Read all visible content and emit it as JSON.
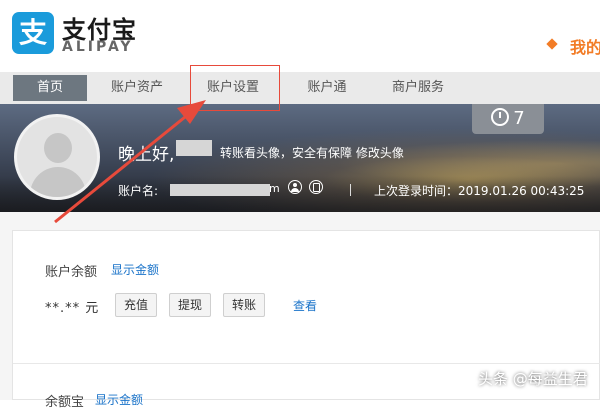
{
  "header": {
    "logo_glyph": "支",
    "logo_cn": "支付宝",
    "logo_en": "ALIPAY",
    "my_text": "我的",
    "accent_color": "#f27c26",
    "brand_color": "#1a9bdb"
  },
  "nav": {
    "items": [
      {
        "label": "首页",
        "active": true
      },
      {
        "label": "账户资产",
        "active": false
      },
      {
        "label": "账户设置",
        "active": false
      },
      {
        "label": "账户通",
        "active": false
      },
      {
        "label": "商户服务",
        "active": false
      }
    ]
  },
  "banner": {
    "alarm_count": "7",
    "greeting": "晚上好,",
    "change_avatar_text": "转账看头像，安全有保障 修改头像",
    "account_label": "账户名:",
    "account_tail": "m",
    "last_login": "上次登录时间：2019.01.26 00:43:25"
  },
  "balance": {
    "label": "账户余额",
    "show_link": "显示金额",
    "amount": "**.** 元",
    "buttons": [
      "充值",
      "提现",
      "转账"
    ],
    "view_link": "查看"
  },
  "next_section": {
    "label": "余额宝",
    "show_link": "显示金额"
  },
  "watermark": "头条 @每益生君"
}
